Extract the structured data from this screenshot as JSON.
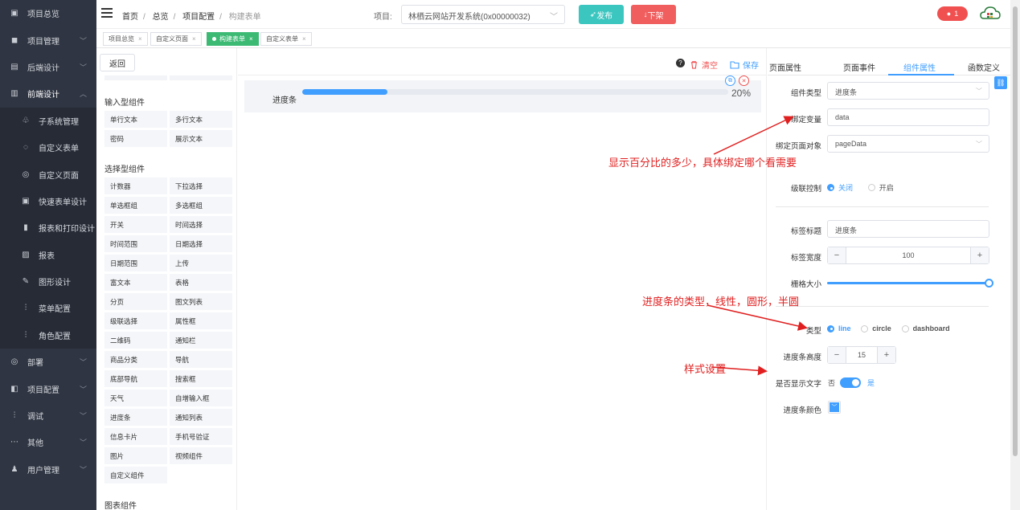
{
  "sidebar": {
    "items": [
      {
        "label": "项目总览",
        "icon": "monitor-icon"
      },
      {
        "label": "项目管理",
        "icon": "grid-icon"
      },
      {
        "label": "后端设计",
        "icon": "server-icon"
      },
      {
        "label": "前端设计",
        "icon": "layout-icon"
      },
      {
        "label": "子系统管理",
        "icon": "sitemap-icon"
      },
      {
        "label": "自定义表单",
        "icon": "form-icon"
      },
      {
        "label": "自定义页面",
        "icon": "page-icon"
      },
      {
        "label": "快速表单设计",
        "icon": "quick-form-icon"
      },
      {
        "label": "报表和打印设计",
        "icon": "print-icon"
      },
      {
        "label": "报表",
        "icon": "report-icon"
      },
      {
        "label": "图形设计",
        "icon": "pencil-icon"
      },
      {
        "label": "菜单配置",
        "icon": "menu-config-icon"
      },
      {
        "label": "角色配置",
        "icon": "role-icon"
      },
      {
        "label": "部署",
        "icon": "deploy-icon"
      },
      {
        "label": "项目配置",
        "icon": "project-config-icon"
      },
      {
        "label": "调试",
        "icon": "debug-icon"
      },
      {
        "label": "其他",
        "icon": "more-icon"
      },
      {
        "label": "用户管理",
        "icon": "user-icon"
      }
    ]
  },
  "header": {
    "breadcrumb": [
      "首页",
      "总览",
      "项目配置",
      "构建表单"
    ],
    "project_label": "项目:",
    "project_value": "林栖云网站开发系统(0x00000032)",
    "publish_label": "发布",
    "offline_label": "下架",
    "notice_count": "1"
  },
  "tags": [
    {
      "label": "项目总览"
    },
    {
      "label": "自定义页面"
    },
    {
      "label": "构建表单"
    },
    {
      "label": "自定义表单"
    }
  ],
  "palette": {
    "back_label": "返回",
    "groups": [
      {
        "title": "输入型组件",
        "items": [
          "单行文本",
          "多行文本",
          "密码",
          "展示文本"
        ]
      },
      {
        "title": "选择型组件",
        "items": [
          "计数器",
          "下拉选择",
          "单选框组",
          "多选框组",
          "开关",
          "时间选择",
          "时间范围",
          "日期选择",
          "日期范围",
          "上传",
          "富文本",
          "表格",
          "分页",
          "图文列表",
          "级联选择",
          "属性框",
          "二维码",
          "通知栏",
          "商品分类",
          "导航",
          "底部导航",
          "搜索框",
          "天气",
          "自增输入框",
          "进度条",
          "通知列表",
          "信息卡片",
          "手机号验证",
          "图片",
          "视频组件",
          "自定义组件"
        ]
      },
      {
        "title": "图表组件",
        "items": []
      }
    ]
  },
  "canvas": {
    "clear_label": "清空",
    "save_label": "保存",
    "progress_label": "进度条",
    "progress_value": 20,
    "progress_text": "20%"
  },
  "props": {
    "tabs": [
      "页面属性",
      "页面事件",
      "组件属性",
      "函数定义"
    ],
    "component_type_label": "组件类型",
    "component_type_value": "进度条",
    "bind_var_label": "绑定变量",
    "bind_var_value": "data",
    "bind_page_label": "绑定页面对象",
    "bind_page_value": "pageData",
    "cascade_label": "级联控制",
    "cascade_off": "关闭",
    "cascade_on": "开启",
    "tag_title_label": "标签标题",
    "tag_title_value": "进度条",
    "tag_width_label": "标签宽度",
    "tag_width_value": "100",
    "grid_size_label": "栅格大小",
    "type_label": "类型",
    "type_line": "line",
    "type_circle": "circle",
    "type_dashboard": "dashboard",
    "height_label": "进度条高度",
    "height_value": "15",
    "show_text_label": "是否显示文字",
    "show_text_no": "否",
    "show_text_yes": "是",
    "color_label": "进度条颜色"
  },
  "annotations": {
    "a1": "显示百分比的多少，具体绑定哪个看需要",
    "a2": "进度条的类型，线性，圆形，半圆",
    "a3": "样式设置"
  },
  "colors": {
    "accent": "#409eff",
    "danger": "#f05050",
    "success": "#3cba74",
    "teal": "#3cc6c0",
    "sidebar": "#2f3542"
  }
}
